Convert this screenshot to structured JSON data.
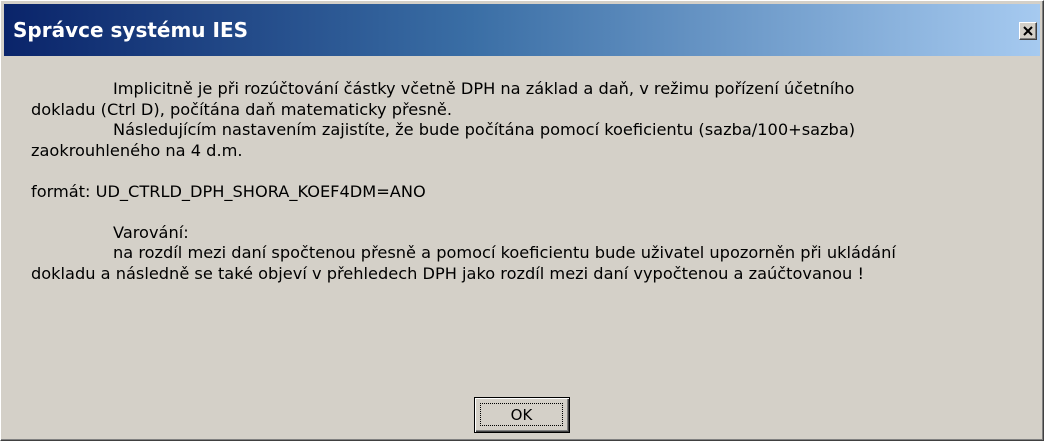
{
  "window": {
    "title": "Správce systému IES",
    "close_label": "✕"
  },
  "message": {
    "lines": [
      "Implicitně je při rozúčtování částky včetně DPH na základ a daň, v režimu pořízení účetního",
      "dokladu (Ctrl D), počítána daň matematicky přesně.",
      "Následujícím nastavením zajistíte, že bude počítána pomocí koeficientu (sazba/100+sazba)",
      "zaokrouhleného na 4 d.m.",
      "formát: UD_CTRLD_DPH_SHORA_KOEF4DM=ANO",
      "Varování:",
      "na rozdíl mezi daní spočtenou přesně a pomocí koeficientu bude uživatel upozorněn při ukládání",
      "dokladu a následně se také objeví v přehledech DPH jako rozdíl mezi daní vypočtenou a zaúčtovanou !"
    ]
  },
  "buttons": {
    "ok_label": "OK"
  },
  "colors": {
    "title_gradient_start": "#0a246a",
    "title_gradient_end": "#a6caf0",
    "dialog_face": "#d4d0c8"
  }
}
